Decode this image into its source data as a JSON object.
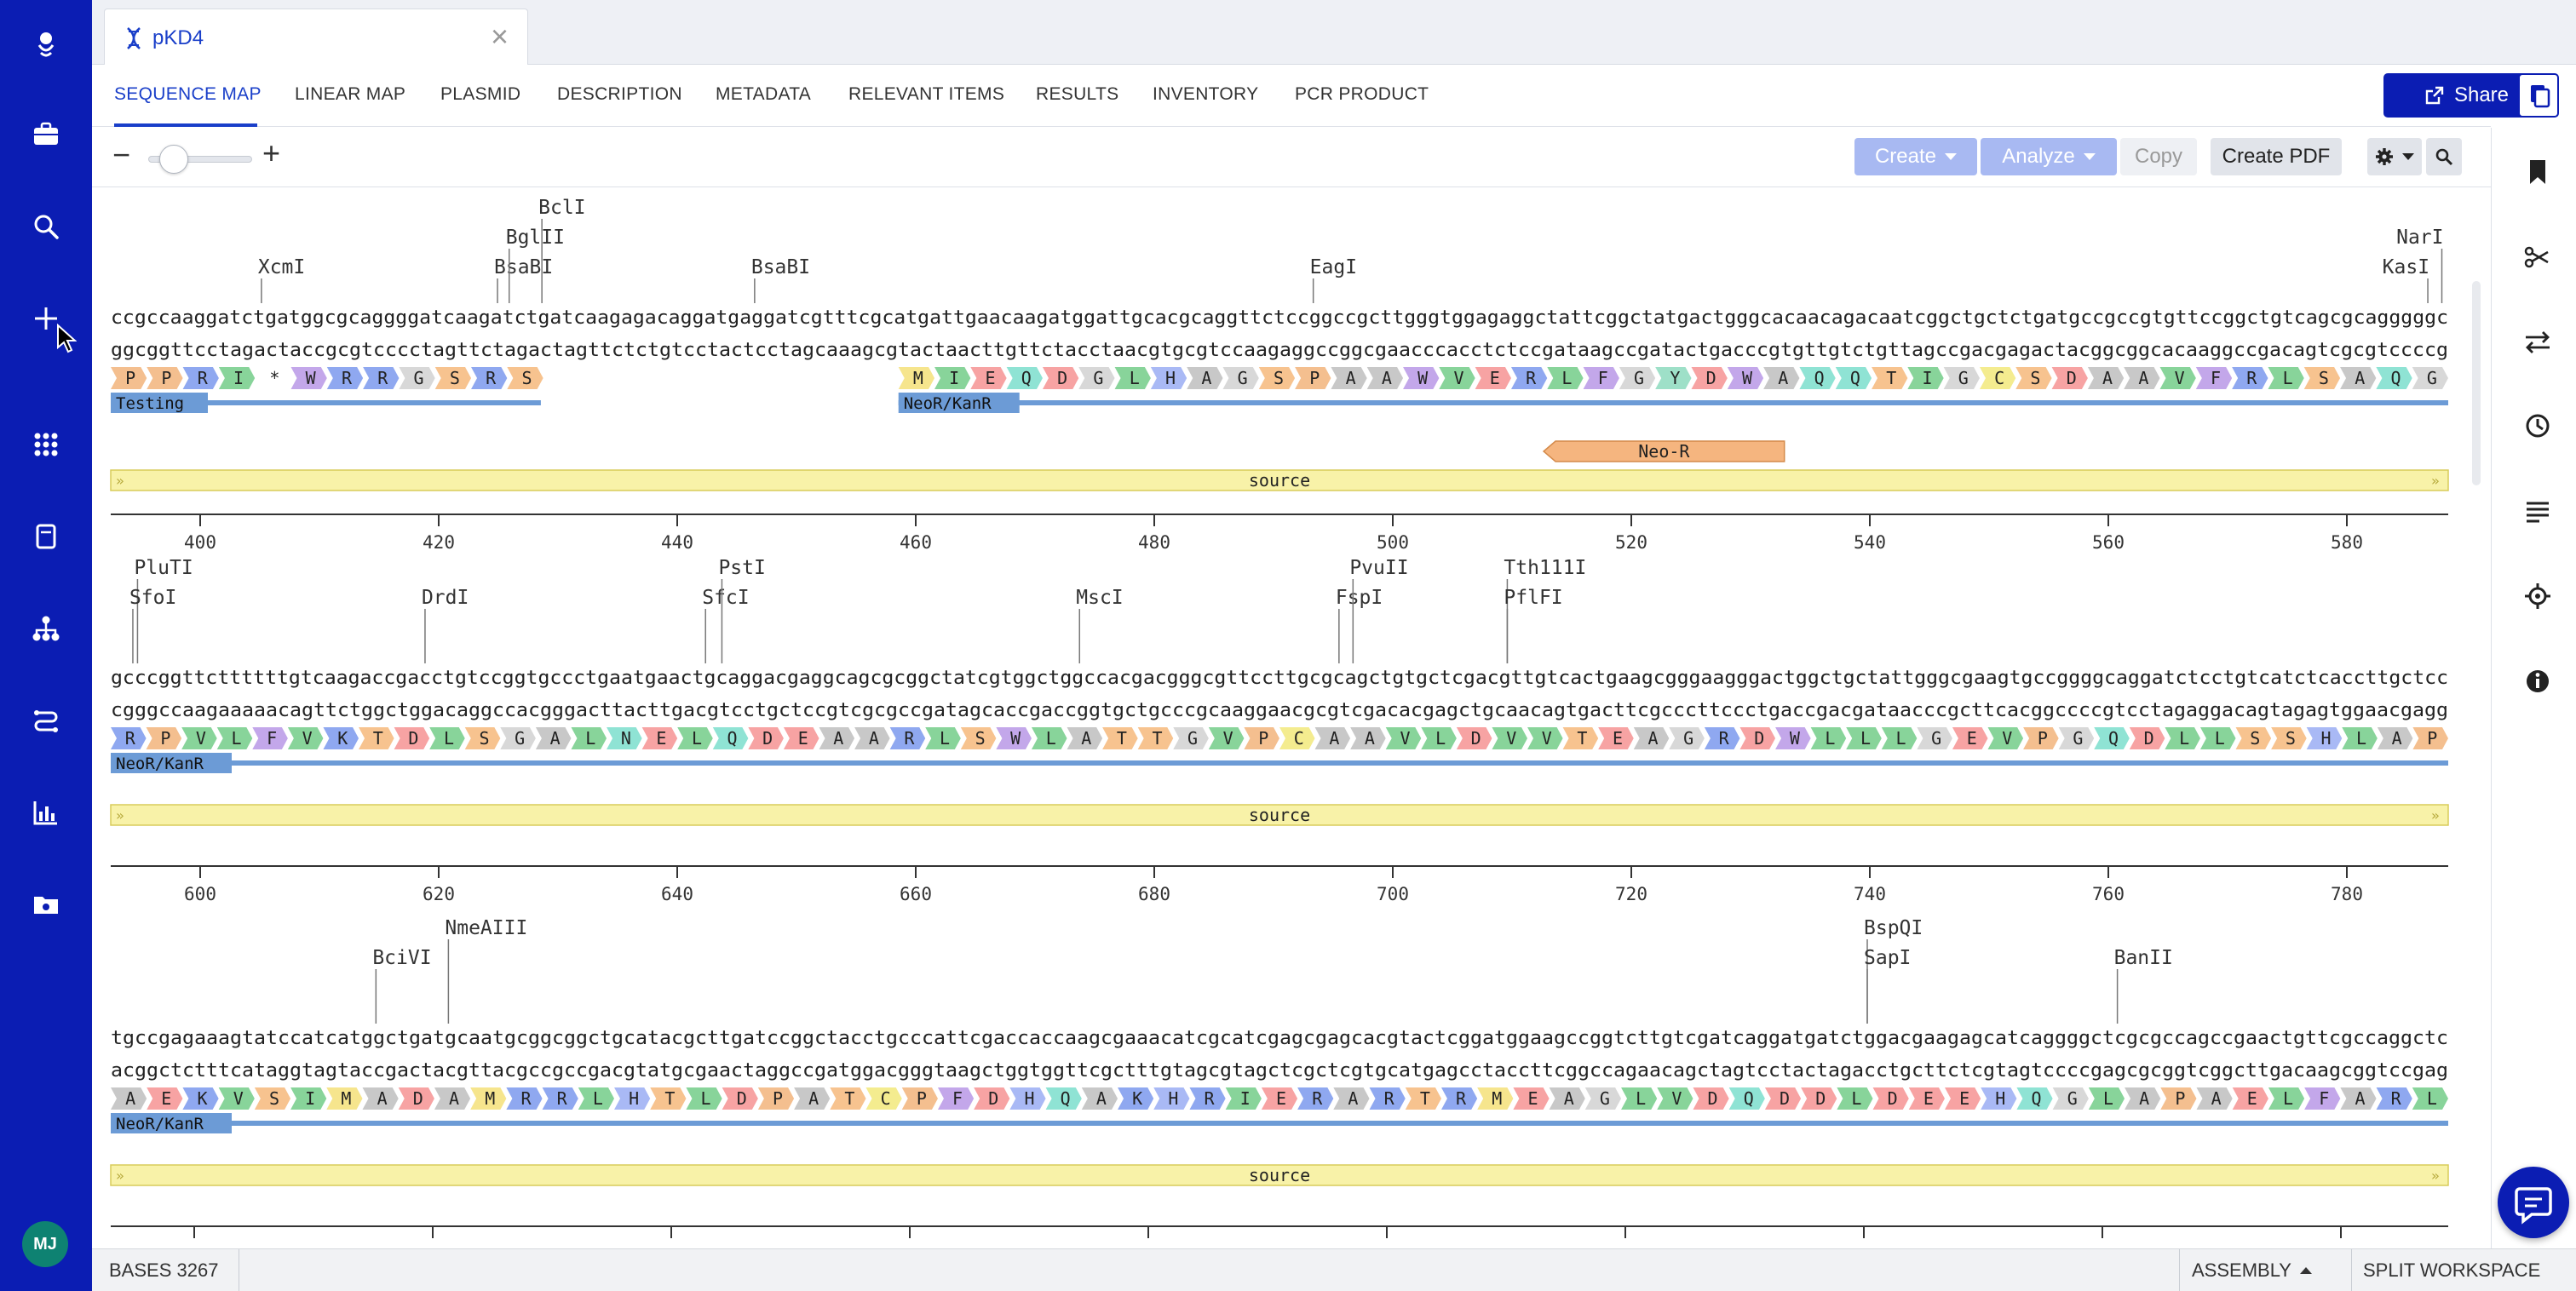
{
  "app": {
    "document_title": "pKD4"
  },
  "user": {
    "initials": "MJ"
  },
  "sidebar_icons": [
    "logo-icon",
    "briefcase-icon",
    "search-icon",
    "plus-icon",
    "apps-grid-icon",
    "notebook-icon",
    "hierarchy-icon",
    "workflow-icon",
    "chart-icon",
    "folder-icon"
  ],
  "nav_tabs": [
    {
      "label": "SEQUENCE MAP",
      "active": true
    },
    {
      "label": "LINEAR MAP"
    },
    {
      "label": "PLASMID"
    },
    {
      "label": "DESCRIPTION"
    },
    {
      "label": "METADATA"
    },
    {
      "label": "RELEVANT ITEMS"
    },
    {
      "label": "RESULTS"
    },
    {
      "label": "INVENTORY"
    },
    {
      "label": "PCR PRODUCT"
    }
  ],
  "share": {
    "label": "Share"
  },
  "toolbar": {
    "create": "Create",
    "analyze": "Analyze",
    "copy": "Copy",
    "create_pdf": "Create PDF",
    "zoom_level": 0.15
  },
  "right_icons": [
    "bookmark-icon",
    "scissors-icon",
    "swap-icon",
    "history-icon",
    "text-lines-icon",
    "target-icon",
    "info-icon"
  ],
  "colors": {
    "brand": "#0b1db3",
    "accent": "#1a3fc9",
    "feature_blue": "#6c9bd6",
    "source_yellow": "#f8f2a8",
    "neo_r": "#f5b57f"
  },
  "status": {
    "bases_label": "BASES",
    "bases_count": "3267",
    "assembly": "ASSEMBLY",
    "split": "SPLIT WORKSPACE"
  },
  "sequence_rows": [
    {
      "top": "ccgccaaggatctgatggcgcaggggatcaagatctgatcaagagacaggatgaggatcgtttcgcatgattgaacaagatggattgcacgcaggttctccggccgcttgggtggagaggctattcggctatgactgggcacaacagacaatcggctgctctgatgccgccgtgttccggctgtcagcgcagggggc",
      "bottom": "ggcggttcctagactaccgcgtcccctagttctagactagttctctgtcctactcctagcaaagcgtactaacttgttctacctaacgtgcgtccaagaggccggcgaacccacctctccgataagccgatactgacccgtgttgtctgttagccgacgagactacggcggcacaaggccgacagtcgcgtccccg",
      "enzymes": [
        {
          "name": "XcmI",
          "pos": 0.063,
          "level": 2
        },
        {
          "name": "BsaBI",
          "pos": 0.164,
          "level": 2
        },
        {
          "name": "BglII",
          "pos": 0.169,
          "level": 1
        },
        {
          "name": "BclI",
          "pos": 0.183,
          "level": 0
        },
        {
          "name": "BsaBI",
          "pos": 0.274,
          "level": 2
        },
        {
          "name": "EagI",
          "pos": 0.513,
          "level": 2
        },
        {
          "name": "NarI",
          "pos": 0.998,
          "level": 1
        },
        {
          "name": "KasI",
          "pos": 0.992,
          "level": 2
        }
      ],
      "translation_segments": [
        {
          "aa": "PPRI*WRRGSRS",
          "start": 0.0,
          "end": 0.185
        },
        {
          "aa": "MIEQDGLHAGSPAAWVERLFGYDWAQQTIGCSDAAVFRLSAQG",
          "start": 0.337,
          "end": 1.0
        }
      ],
      "features": [
        {
          "label": "Testing",
          "start": 0.0,
          "end": 0.184
        },
        {
          "label": "NeoR/KanR",
          "start": 0.337,
          "end": 1.0
        }
      ],
      "primer": {
        "label": "Neo-R",
        "start": 0.613,
        "end": 0.716
      },
      "source_label": "source",
      "ticks": [
        400,
        420,
        440,
        460,
        480,
        500,
        520,
        540,
        560,
        580
      ]
    },
    {
      "top": "gcccggttcttttttgtcaagaccgacctgtccggtgccctgaatgaactgcaggacgaggcagcgcggctatcgtggctggccacgacgggcgttccttgcgcagctgtgctcgacgttgtcactgaagcgggaagggactggctgctattgggcgaagtgccggggcaggatctcctgtcatctcaccttgctcc",
      "bottom": "cgggccaagaaaaacagttctggctggacaggccacgggacttacttgacgtcctgctccgtcgcgccgatagcaccgaccggtgctgcccgcaaggaacgcgtcgacacgagctgcaacagtgacttcgcccttccctgaccgacgataacccgcttcacggccccgtcctagaggacagtagagtggaacgagg",
      "enzymes": [
        {
          "name": "PluTI",
          "pos": 0.01,
          "level": 0
        },
        {
          "name": "SfoI",
          "pos": 0.008,
          "level": 1
        },
        {
          "name": "DrdI",
          "pos": 0.133,
          "level": 1
        },
        {
          "name": "SfcI",
          "pos": 0.253,
          "level": 1
        },
        {
          "name": "PstI",
          "pos": 0.26,
          "level": 0
        },
        {
          "name": "MscI",
          "pos": 0.413,
          "level": 1
        },
        {
          "name": "FspI",
          "pos": 0.524,
          "level": 1
        },
        {
          "name": "PvuII",
          "pos": 0.53,
          "level": 0
        },
        {
          "name": "Tth111I",
          "pos": 0.596,
          "level": 0
        },
        {
          "name": "PflFI",
          "pos": 0.596,
          "level": 1
        }
      ],
      "translation_segments": [
        {
          "aa": "RPVLFVKTDLSGALNELQDEAARLSWLATTGVPCAAVLDVVTEAGRDWLLLGEVPGQDLLSSHLAP",
          "start": 0.0,
          "end": 1.0
        }
      ],
      "features": [
        {
          "label": "NeoR/KanR",
          "start": 0.0,
          "end": 1.0
        }
      ],
      "source_label": "source",
      "ticks": [
        600,
        620,
        640,
        660,
        680,
        700,
        720,
        740,
        760,
        780
      ]
    },
    {
      "top": "tgccgagaaagtatccatcatggctgatgcaatgcggcggctgcatacgcttgatccggctacctgcccattcgaccaccaagcgaaacatcgcatcgagcgagcacgtactcggatggaagccggtcttgtcgatcaggatgatctggacgaagagcatcaggggctcgcgccagccgaactgttcgccaggctc",
      "bottom": "acggctctttcataggtagtaccgactacgttacgccgccgacgtatgcgaactaggccgatggacgggtaagctggtggttcgctttgtagcgtagctcgctcgtgcatgagcctaccttcggccagaacagctagtcctactagacctgcttctcgtagtccccgagcgcggtcggcttgacaagcggtccgag",
      "enzymes": [
        {
          "name": "BciVI",
          "pos": 0.112,
          "level": 1
        },
        {
          "name": "NmeAIII",
          "pos": 0.143,
          "level": 0
        },
        {
          "name": "BspQI",
          "pos": 0.75,
          "level": 0
        },
        {
          "name": "SapI",
          "pos": 0.75,
          "level": 1
        },
        {
          "name": "BanII",
          "pos": 0.857,
          "level": 1
        }
      ],
      "translation_segments": [
        {
          "aa": "AEKVSIMADAMRRLHTLDPATCPFDHQAKHRIERARTRMEAGLVDQDDLDEEHQGLAPAELFARL",
          "start": 0.0,
          "end": 1.0
        }
      ],
      "features": [
        {
          "label": "NeoR/KanR",
          "start": 0.0,
          "end": 1.0
        }
      ],
      "source_label": "source",
      "ticks": []
    }
  ]
}
